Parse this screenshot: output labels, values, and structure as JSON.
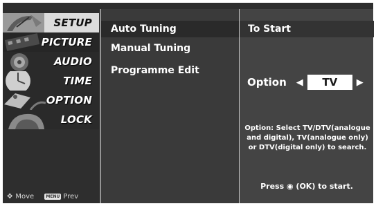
{
  "menu": {
    "categories": [
      {
        "label": "SETUP",
        "icon": "satellite-dish-icon",
        "active": true
      },
      {
        "label": "PICTURE",
        "icon": "film-strip-icon",
        "active": false
      },
      {
        "label": "AUDIO",
        "icon": "speaker-icon",
        "active": false
      },
      {
        "label": "TIME",
        "icon": "clock-icon",
        "active": false
      },
      {
        "label": "OPTION",
        "icon": "option-tag-icon",
        "active": false
      },
      {
        "label": "LOCK",
        "icon": "padlock-icon",
        "active": false
      }
    ],
    "hints": {
      "move_label": "Move",
      "menu_key": "MENU",
      "prev_label": "Prev"
    }
  },
  "setup": {
    "items": [
      {
        "label": "Auto Tuning",
        "selected": true
      },
      {
        "label": "Manual Tuning",
        "selected": false
      },
      {
        "label": "Programme Edit",
        "selected": false
      }
    ]
  },
  "detail": {
    "header": "To Start",
    "option_label": "Option",
    "option_value": "TV",
    "description": "Option: Select TV/DTV(analogue and digital), TV(analogue only) or DTV(digital only) to search.",
    "press_prefix": "Press",
    "press_suffix": "(OK) to start."
  },
  "colors": {
    "panel_dark": "#2e2e2e",
    "panel_mid": "#3a3a3a",
    "panel_right": "#444444",
    "divider": "#c8c8c8",
    "text": "#ffffff"
  }
}
